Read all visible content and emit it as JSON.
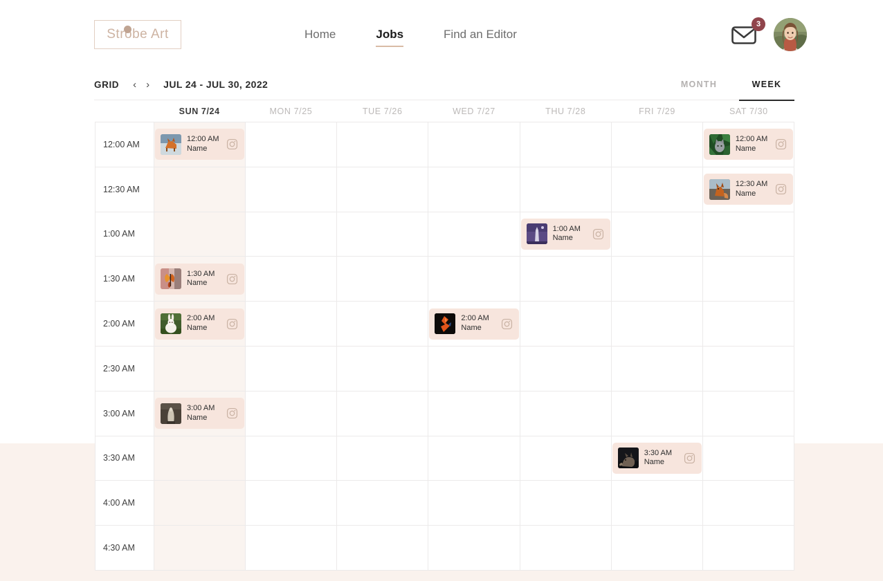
{
  "brand": {
    "logo_text": "Strobe Art"
  },
  "nav": {
    "items": [
      {
        "label": "Home",
        "active": false
      },
      {
        "label": "Jobs",
        "active": true
      },
      {
        "label": "Find an Editor",
        "active": false
      }
    ]
  },
  "header": {
    "mail_icon": "envelope-icon",
    "mail_badge_count": "3",
    "avatar_icon": "user-avatar"
  },
  "toolbar": {
    "grid_label": "GRID",
    "prev_arrow": "‹",
    "next_arrow": "›",
    "date_range": "JUL 24 - JUL 30, 2022",
    "views": [
      {
        "label": "MONTH",
        "active": false
      },
      {
        "label": "WEEK",
        "active": true
      }
    ]
  },
  "calendar": {
    "day_headers": [
      {
        "label": "SUN 7/24",
        "today": true
      },
      {
        "label": "MON 7/25",
        "today": false
      },
      {
        "label": "TUE 7/26",
        "today": false
      },
      {
        "label": "WED 7/27",
        "today": false
      },
      {
        "label": "THU 7/28",
        "today": false
      },
      {
        "label": "FRI 7/29",
        "today": false
      },
      {
        "label": "SAT 7/30",
        "today": false
      }
    ],
    "time_slots": [
      "12:00 AM",
      "12:30 AM",
      "1:00 AM",
      "1:30 AM",
      "2:00 AM",
      "2:30 AM",
      "3:00 AM",
      "3:30 AM",
      "4:00 AM",
      "4:30 AM"
    ],
    "events": [
      {
        "row": 0,
        "day": 0,
        "time": "12:00 AM",
        "name": "Name",
        "icon": "instagram-icon",
        "thumb": "fox-snow"
      },
      {
        "row": 0,
        "day": 6,
        "time": "12:00 AM",
        "name": "Name",
        "icon": "instagram-icon",
        "thumb": "cat-leaves"
      },
      {
        "row": 1,
        "day": 6,
        "time": "12:30 AM",
        "name": "Name",
        "icon": "instagram-icon",
        "thumb": "fox-rock"
      },
      {
        "row": 2,
        "day": 4,
        "time": "1:00 AM",
        "name": "Name",
        "icon": "instagram-icon",
        "thumb": "purple-tower"
      },
      {
        "row": 3,
        "day": 0,
        "time": "1:30 AM",
        "name": "Name",
        "icon": "instagram-icon",
        "thumb": "butterfly"
      },
      {
        "row": 4,
        "day": 0,
        "time": "2:00 AM",
        "name": "Name",
        "icon": "instagram-icon",
        "thumb": "white-rabbit"
      },
      {
        "row": 4,
        "day": 3,
        "time": "2:00 AM",
        "name": "Name",
        "icon": "instagram-icon",
        "thumb": "orange-dark"
      },
      {
        "row": 6,
        "day": 0,
        "time": "3:00 AM",
        "name": "Name",
        "icon": "instagram-icon",
        "thumb": "stone-figure"
      },
      {
        "row": 7,
        "day": 5,
        "time": "3:30 AM",
        "name": "Name",
        "icon": "instagram-icon",
        "thumb": "dark-wolf"
      }
    ]
  },
  "colors": {
    "accent": "#d9bca6",
    "badge": "#90444b",
    "event_bg": "#f7e5dd",
    "sunday_bg": "#faf4f0",
    "page_bottom_bg": "#faf2ed",
    "grid_line": "#eceaea"
  }
}
